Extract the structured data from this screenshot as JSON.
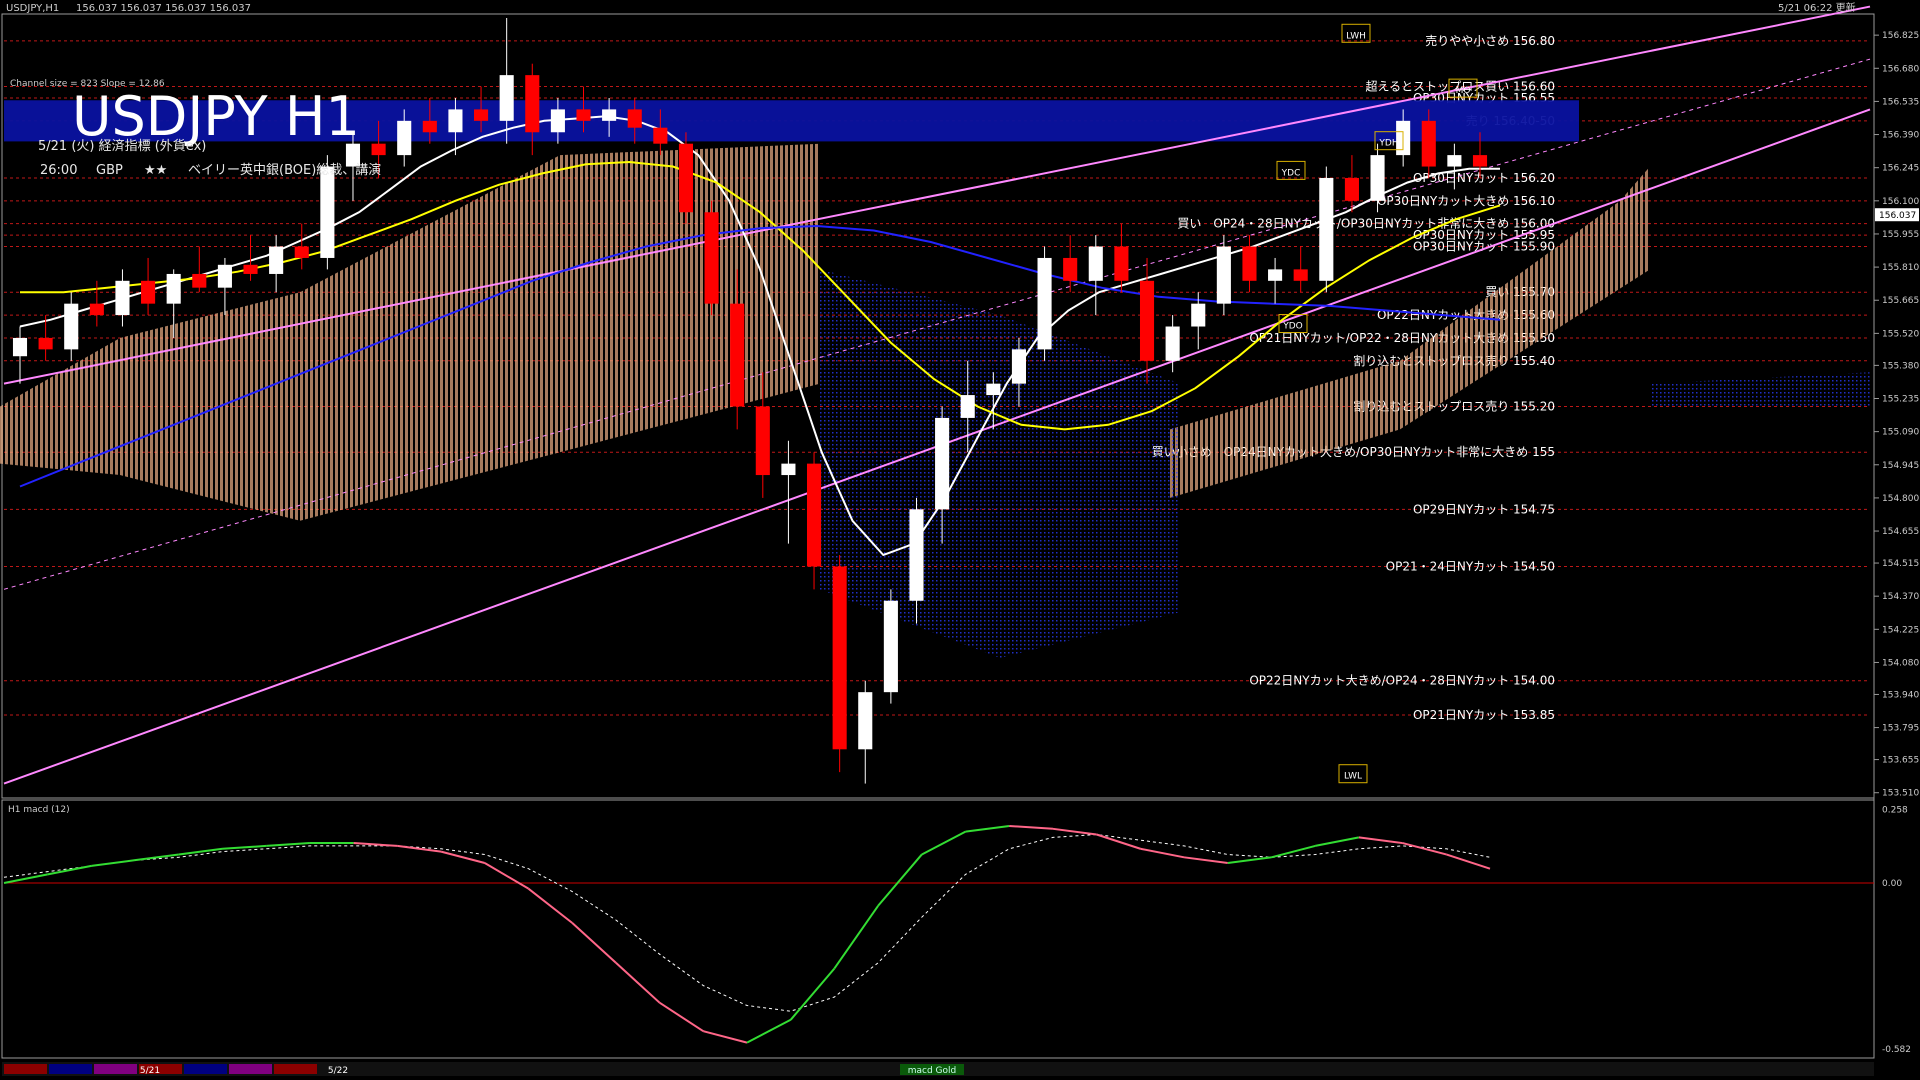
{
  "window": {
    "title": "USDJPY,H1",
    "ohlc": "156.037 156.037 156.037 156.037",
    "datetime": "5/21 06:22 更新"
  },
  "overlay": {
    "channel_info": "Channel size = 823 Slope = 12.86",
    "symbol_tf": "USDJPY H1",
    "event_header": "5/21 (火) 経済指標 (外貨ex)",
    "event_time": "26:00",
    "event_ccy": "GBP",
    "event_stars": "★★",
    "event_name": "ベイリー英中銀(BOE)総裁、講演"
  },
  "colors": {
    "background": "#000000",
    "bull_candle": "#ffffff",
    "bear_candle": "#ff0000",
    "ma_fast": "#ffffff",
    "ma_mid": "#ffff00",
    "ma_slow": "#2222ff",
    "channel": "#ff88ff",
    "level_line": "#ff2020",
    "macd_up": "#33dd33",
    "macd_down": "#ff6688",
    "sell_band": "#0a12a0",
    "cloud_up": "#f5b58a",
    "cloud_down": "#2a3cff"
  },
  "chart_data": {
    "type": "candlestick",
    "price_axis_ticks": [
      "156.825",
      "156.680",
      "156.535",
      "156.390",
      "156.245",
      "156.100",
      "155.955",
      "155.810",
      "155.665",
      "155.520",
      "155.380",
      "155.235",
      "155.090",
      "154.945",
      "154.800",
      "154.655",
      "154.515",
      "154.370",
      "154.225",
      "154.080",
      "153.940",
      "153.795",
      "153.655",
      "153.510"
    ],
    "current_price": "156.037",
    "ylim": [
      153.5,
      156.9
    ],
    "candles": [
      {
        "o": 155.42,
        "h": 155.55,
        "l": 155.3,
        "c": 155.5
      },
      {
        "o": 155.5,
        "h": 155.6,
        "l": 155.4,
        "c": 155.45
      },
      {
        "o": 155.45,
        "h": 155.7,
        "l": 155.4,
        "c": 155.65
      },
      {
        "o": 155.65,
        "h": 155.75,
        "l": 155.55,
        "c": 155.6
      },
      {
        "o": 155.6,
        "h": 155.8,
        "l": 155.55,
        "c": 155.75
      },
      {
        "o": 155.75,
        "h": 155.85,
        "l": 155.6,
        "c": 155.65
      },
      {
        "o": 155.65,
        "h": 155.8,
        "l": 155.5,
        "c": 155.78
      },
      {
        "o": 155.78,
        "h": 155.9,
        "l": 155.7,
        "c": 155.72
      },
      {
        "o": 155.72,
        "h": 155.85,
        "l": 155.6,
        "c": 155.82
      },
      {
        "o": 155.82,
        "h": 155.95,
        "l": 155.75,
        "c": 155.78
      },
      {
        "o": 155.78,
        "h": 155.95,
        "l": 155.7,
        "c": 155.9
      },
      {
        "o": 155.9,
        "h": 156.0,
        "l": 155.8,
        "c": 155.85
      },
      {
        "o": 155.85,
        "h": 156.3,
        "l": 155.8,
        "c": 156.25
      },
      {
        "o": 156.25,
        "h": 156.4,
        "l": 156.1,
        "c": 156.35
      },
      {
        "o": 156.35,
        "h": 156.45,
        "l": 156.2,
        "c": 156.3
      },
      {
        "o": 156.3,
        "h": 156.5,
        "l": 156.25,
        "c": 156.45
      },
      {
        "o": 156.45,
        "h": 156.55,
        "l": 156.35,
        "c": 156.4
      },
      {
        "o": 156.4,
        "h": 156.55,
        "l": 156.3,
        "c": 156.5
      },
      {
        "o": 156.5,
        "h": 156.6,
        "l": 156.4,
        "c": 156.45
      },
      {
        "o": 156.45,
        "h": 156.9,
        "l": 156.35,
        "c": 156.65
      },
      {
        "o": 156.65,
        "h": 156.7,
        "l": 156.3,
        "c": 156.4
      },
      {
        "o": 156.4,
        "h": 156.55,
        "l": 156.35,
        "c": 156.5
      },
      {
        "o": 156.5,
        "h": 156.6,
        "l": 156.4,
        "c": 156.45
      },
      {
        "o": 156.45,
        "h": 156.55,
        "l": 156.38,
        "c": 156.5
      },
      {
        "o": 156.5,
        "h": 156.55,
        "l": 156.35,
        "c": 156.42
      },
      {
        "o": 156.42,
        "h": 156.5,
        "l": 156.3,
        "c": 156.35
      },
      {
        "o": 156.35,
        "h": 156.4,
        "l": 156.0,
        "c": 156.05
      },
      {
        "o": 156.05,
        "h": 156.1,
        "l": 155.6,
        "c": 155.65
      },
      {
        "o": 155.65,
        "h": 155.8,
        "l": 155.1,
        "c": 155.2
      },
      {
        "o": 155.2,
        "h": 155.35,
        "l": 154.8,
        "c": 154.9
      },
      {
        "o": 154.9,
        "h": 155.05,
        "l": 154.6,
        "c": 154.95
      },
      {
        "o": 154.95,
        "h": 155.0,
        "l": 154.4,
        "c": 154.5
      },
      {
        "o": 154.5,
        "h": 154.55,
        "l": 153.6,
        "c": 153.7
      },
      {
        "o": 153.7,
        "h": 154.0,
        "l": 153.55,
        "c": 153.95
      },
      {
        "o": 153.95,
        "h": 154.4,
        "l": 153.9,
        "c": 154.35
      },
      {
        "o": 154.35,
        "h": 154.8,
        "l": 154.25,
        "c": 154.75
      },
      {
        "o": 154.75,
        "h": 155.2,
        "l": 154.6,
        "c": 155.15
      },
      {
        "o": 155.15,
        "h": 155.4,
        "l": 155.0,
        "c": 155.25
      },
      {
        "o": 155.25,
        "h": 155.35,
        "l": 155.1,
        "c": 155.3
      },
      {
        "o": 155.3,
        "h": 155.5,
        "l": 155.2,
        "c": 155.45
      },
      {
        "o": 155.45,
        "h": 155.9,
        "l": 155.4,
        "c": 155.85
      },
      {
        "o": 155.85,
        "h": 155.95,
        "l": 155.7,
        "c": 155.75
      },
      {
        "o": 155.75,
        "h": 155.95,
        "l": 155.6,
        "c": 155.9
      },
      {
        "o": 155.9,
        "h": 156.0,
        "l": 155.7,
        "c": 155.75
      },
      {
        "o": 155.75,
        "h": 155.85,
        "l": 155.3,
        "c": 155.4
      },
      {
        "o": 155.4,
        "h": 155.6,
        "l": 155.35,
        "c": 155.55
      },
      {
        "o": 155.55,
        "h": 155.7,
        "l": 155.45,
        "c": 155.65
      },
      {
        "o": 155.65,
        "h": 155.95,
        "l": 155.6,
        "c": 155.9
      },
      {
        "o": 155.9,
        "h": 155.95,
        "l": 155.7,
        "c": 155.75
      },
      {
        "o": 155.75,
        "h": 155.85,
        "l": 155.65,
        "c": 155.8
      },
      {
        "o": 155.8,
        "h": 155.9,
        "l": 155.7,
        "c": 155.75
      },
      {
        "o": 155.75,
        "h": 156.25,
        "l": 155.7,
        "c": 156.2
      },
      {
        "o": 156.2,
        "h": 156.3,
        "l": 156.05,
        "c": 156.1
      },
      {
        "o": 156.1,
        "h": 156.35,
        "l": 156.05,
        "c": 156.3
      },
      {
        "o": 156.3,
        "h": 156.5,
        "l": 156.25,
        "c": 156.45
      },
      {
        "o": 156.45,
        "h": 156.5,
        "l": 156.2,
        "c": 156.25
      },
      {
        "o": 156.25,
        "h": 156.35,
        "l": 156.15,
        "c": 156.3
      },
      {
        "o": 156.3,
        "h": 156.4,
        "l": 156.2,
        "c": 156.25
      }
    ],
    "moving_averages": [
      {
        "name": "ma_fast",
        "color": "#ffffff",
        "values": [
          155.55,
          155.58,
          155.62,
          155.66,
          155.7,
          155.74,
          155.78,
          155.82,
          155.86,
          155.92,
          155.98,
          156.05,
          156.15,
          156.25,
          156.32,
          156.38,
          156.42,
          156.45,
          156.46,
          156.47,
          156.45,
          156.4,
          156.3,
          156.1,
          155.8,
          155.4,
          155.0,
          154.7,
          154.55,
          154.6,
          154.8,
          155.05,
          155.3,
          155.5,
          155.62,
          155.7,
          155.74,
          155.78,
          155.82,
          155.86,
          155.9,
          155.95,
          156.0,
          156.05,
          156.12,
          156.18,
          156.22,
          156.24,
          156.24
        ]
      },
      {
        "name": "ma_mid",
        "color": "#ffff00",
        "values": [
          155.7,
          155.7,
          155.72,
          155.74,
          155.76,
          155.79,
          155.83,
          155.88,
          155.95,
          156.02,
          156.1,
          156.17,
          156.22,
          156.26,
          156.27,
          156.25,
          156.18,
          156.05,
          155.88,
          155.68,
          155.48,
          155.32,
          155.2,
          155.12,
          155.1,
          155.12,
          155.18,
          155.28,
          155.42,
          155.58,
          155.72,
          155.84,
          155.94,
          156.02,
          156.08
        ]
      },
      {
        "name": "ma_slow",
        "color": "#2222ff",
        "values": [
          154.85,
          154.95,
          155.05,
          155.15,
          155.25,
          155.35,
          155.45,
          155.55,
          155.65,
          155.75,
          155.83,
          155.9,
          155.95,
          155.98,
          155.99,
          155.97,
          155.92,
          155.85,
          155.78,
          155.72,
          155.68,
          155.66,
          155.65,
          155.64,
          155.62,
          155.6,
          155.58
        ]
      }
    ],
    "channel": {
      "upper": [
        155.3,
        156.95
      ],
      "lower": [
        153.55,
        156.5
      ],
      "mid": [
        154.4,
        156.72
      ]
    },
    "sell_zone": [
      156.4,
      156.5
    ],
    "level_lines": [
      {
        "label": "売りやや小さめ 156.80",
        "price": 156.8
      },
      {
        "label": "超えるとストップロス買い 156.60",
        "price": 156.6
      },
      {
        "label": "OP30日NYカット 156.55",
        "price": 156.55
      },
      {
        "label": "売り 156.40-50",
        "price": 156.45
      },
      {
        "label": "OP30日NYカット 156.20",
        "price": 156.2
      },
      {
        "label": "OP30日NYカット大きめ 156.10",
        "price": 156.1
      },
      {
        "label": "買い　OP24・28日NYカット/OP30日NYカット非常に大きめ 156.00",
        "price": 156.0
      },
      {
        "label": "OP30日NYカット 155.95",
        "price": 155.95
      },
      {
        "label": "OP30日NYカット 155.90",
        "price": 155.9
      },
      {
        "label": "買い 155.70",
        "price": 155.7
      },
      {
        "label": "OP22日NYカット大きめ 155.60",
        "price": 155.6
      },
      {
        "label": "OP21日NYカット/OP22・28日NYカット大きめ 155.50",
        "price": 155.5
      },
      {
        "label": "割り込むとストップロス売り 155.40",
        "price": 155.4
      },
      {
        "label": "割り込むとストップロス売り 155.20",
        "price": 155.2
      },
      {
        "label": "買い小さめ　OP24日NYカット大きめ/OP30日NYカット非常に大きめ 155",
        "price": 155.0
      },
      {
        "label": "OP29日NYカット 154.75",
        "price": 154.75
      },
      {
        "label": "OP21・24日NYカット 154.50",
        "price": 154.5
      },
      {
        "label": "OP22日NYカット大きめ/OP24・28日NYカット 154.00",
        "price": 154.0
      },
      {
        "label": "OP21日NYカット 153.85",
        "price": 153.85
      }
    ],
    "markers": [
      {
        "label": "LWH",
        "price": 156.82
      },
      {
        "label": "YDH",
        "price": 156.35
      },
      {
        "label": "YDC",
        "price": 156.22
      },
      {
        "label": "YDO",
        "price": 155.55
      },
      {
        "label": "LWL",
        "price": 153.58
      },
      {
        "label": "MO",
        "price": 156.58
      }
    ],
    "macd": {
      "title": "H1 macd (12)",
      "ticks": [
        "0.258",
        "0.00",
        "-0.582"
      ],
      "ylim": [
        -0.6,
        0.27
      ],
      "values": [
        0.0,
        0.03,
        0.06,
        0.08,
        0.1,
        0.12,
        0.13,
        0.14,
        0.14,
        0.13,
        0.11,
        0.07,
        -0.02,
        -0.14,
        -0.28,
        -0.42,
        -0.52,
        -0.56,
        -0.48,
        -0.3,
        -0.08,
        0.1,
        0.18,
        0.2,
        0.19,
        0.17,
        0.12,
        0.09,
        0.07,
        0.09,
        0.13,
        0.16,
        0.14,
        0.1,
        0.05
      ],
      "signal": [
        0.02,
        0.04,
        0.06,
        0.08,
        0.09,
        0.11,
        0.12,
        0.13,
        0.13,
        0.13,
        0.12,
        0.1,
        0.05,
        -0.03,
        -0.13,
        -0.25,
        -0.36,
        -0.43,
        -0.45,
        -0.4,
        -0.28,
        -0.12,
        0.03,
        0.12,
        0.16,
        0.17,
        0.15,
        0.13,
        0.1,
        0.09,
        0.1,
        0.12,
        0.13,
        0.12,
        0.09
      ]
    },
    "date_labels": [
      "5/21",
      "5/22"
    ],
    "bottom_tab": "macd Gold"
  }
}
